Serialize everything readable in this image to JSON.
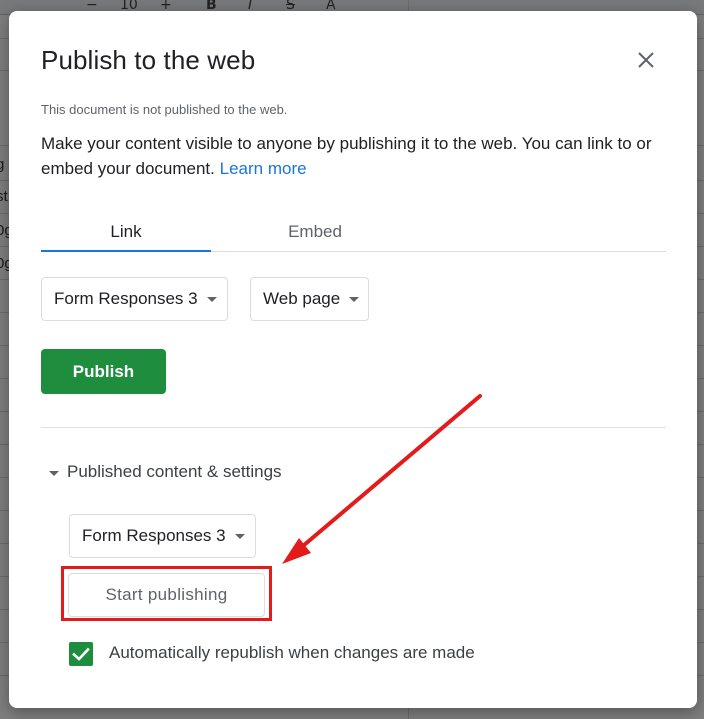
{
  "dialog": {
    "title": "Publish to the web",
    "status": "This document is not published to the web.",
    "description": "Make your content visible to anyone by publishing it to the web. You can link to or embed your document.",
    "learn_more": "Learn more"
  },
  "tabs": [
    {
      "label": "Link",
      "active": true
    },
    {
      "label": "Embed",
      "active": false
    }
  ],
  "selectors": {
    "sheet": "Form Responses 3",
    "format": "Web page"
  },
  "publish_button": "Publish",
  "published_section": {
    "toggle_label": "Published content & settings",
    "sheet": "Form Responses 3",
    "start_button": "Start publishing",
    "auto_republish_label": "Automatically republish when changes are made",
    "auto_republish_checked": true
  },
  "background": {
    "toolbar_items": [
      "−",
      "10",
      "+",
      "B",
      "I",
      "S",
      "A"
    ],
    "cell_fragments": [
      "g",
      "st",
      "0g",
      "0g"
    ]
  },
  "colors": {
    "accent_blue": "#1a73e8",
    "publish_green": "#1e8e3e",
    "highlight_red": "#e31b1b"
  }
}
